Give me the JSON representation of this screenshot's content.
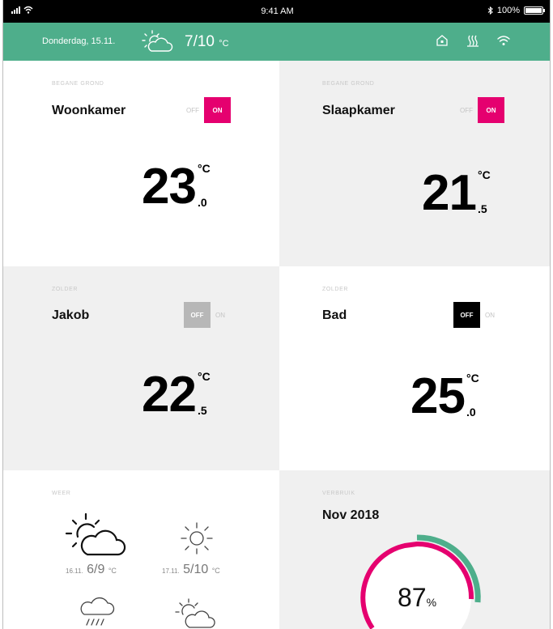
{
  "status_bar": {
    "time": "9:41 AM",
    "battery": "100%"
  },
  "header": {
    "date": "Donderdag, 15.11.",
    "temp": "7/10",
    "unit": "°C",
    "weather_icon": "partly-cloudy-icon",
    "icons": [
      "home-icon",
      "heating-icon",
      "wifi-icon"
    ],
    "color": "#4eae8b"
  },
  "rooms": [
    {
      "floor": "BEGANE GROND",
      "name": "Woonkamer",
      "off": "OFF",
      "on": "ON",
      "state": "on",
      "temp": "23",
      "decimal": ".0",
      "unit": "°C"
    },
    {
      "floor": "BEGANE GROND",
      "name": "Slaapkamer",
      "off": "OFF",
      "on": "ON",
      "state": "on",
      "temp": "21",
      "decimal": ".5",
      "unit": "°C"
    },
    {
      "floor": "ZOLDER",
      "name": "Jakob",
      "off": "OFF",
      "on": "ON",
      "state": "off",
      "temp": "22",
      "decimal": ".5",
      "unit": "°C"
    },
    {
      "floor": "ZOLDER",
      "name": "Bad",
      "off": "OFF",
      "on": "ON",
      "state": "off",
      "temp": "25",
      "decimal": ".0",
      "unit": "°C"
    }
  ],
  "weather": {
    "label": "WEER",
    "forecast": [
      {
        "date": "16.11.",
        "range": "6/9",
        "unit": "°C",
        "icon": "partly-cloudy-icon"
      },
      {
        "date": "17.11.",
        "range": "5/10",
        "unit": "°C",
        "icon": "sun-icon"
      },
      {
        "icon": "rain-cloud-icon"
      },
      {
        "icon": "partly-cloudy-icon"
      }
    ]
  },
  "usage": {
    "label": "VERBRUIK",
    "title": "Nov 2018",
    "percent": "87",
    "unit": "%"
  },
  "colors": {
    "accent": "#4eae8b",
    "on": "#e5006f",
    "gauge_pink": "#e5006f",
    "gauge_teal": "#4eae8b"
  }
}
